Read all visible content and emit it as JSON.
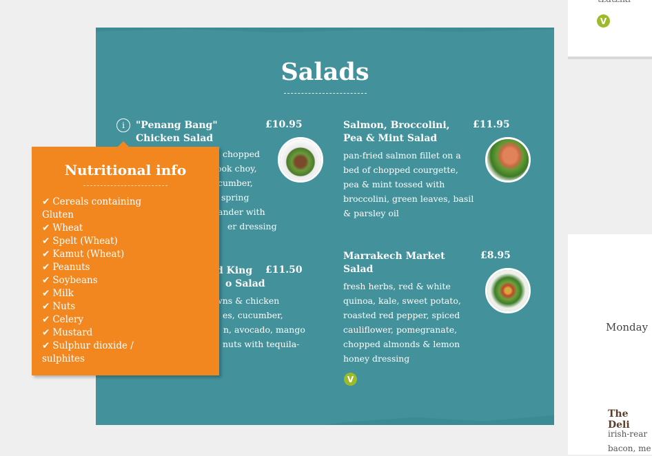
{
  "top_card": {
    "text": "tzatziki",
    "badge": "V"
  },
  "right_card": {
    "day": "Monday",
    "dish": "The Deli",
    "desc_line1": "irish-rear",
    "desc_line2": "bacon, me"
  },
  "panel": {
    "title": "Salads",
    "items": [
      {
        "name1": "\"Penang Bang\"",
        "name2": "Chicken Salad",
        "price": "£10.95",
        "desc": [
          "chopped",
          "ook choy,",
          "cumber,",
          "spring",
          "ander with",
          "er dressing"
        ]
      },
      {
        "name1": "Salmon, Broccolini,",
        "name2": "Pea & Mint Salad",
        "price": "£11.95",
        "desc": [
          "pan-fried salmon fillet on a",
          "bed of chopped courgette,",
          "pea & mint tossed with",
          "broccolini, green leaves, basil",
          "& parsley oil"
        ]
      },
      {
        "name1": "d King",
        "name2": "o Salad",
        "price": "£11.50",
        "desc": [
          "wns & chicken",
          "es, cucumber,",
          "n, avocado, mango",
          "nuts with tequila-"
        ]
      },
      {
        "name1": "Marrakech Market",
        "name2": "Salad",
        "price": "£8.95",
        "desc": [
          "fresh herbs, red & white",
          "quinoa, kale, sweet potato,",
          "roasted red pepper, spiced",
          "cauliflower, pomegranate,",
          "chopped almonds & lemon",
          "honey dressing"
        ],
        "badge": "V"
      }
    ]
  },
  "nutrition": {
    "title": "Nutritional info",
    "check": "✔",
    "items": [
      "Cereals containing Gluten",
      "Wheat",
      "Spelt (Wheat)",
      "Kamut (Wheat)",
      "Peanuts",
      "Soybeans",
      "Milk",
      "Nuts",
      "Celery",
      "Mustard",
      "Sulphur dioxide / sulphites"
    ]
  },
  "icons": {
    "info": "i"
  },
  "colors": {
    "panel": "#42919b",
    "popup": "#f1871e",
    "veg_badge": "#9bbb2a"
  }
}
